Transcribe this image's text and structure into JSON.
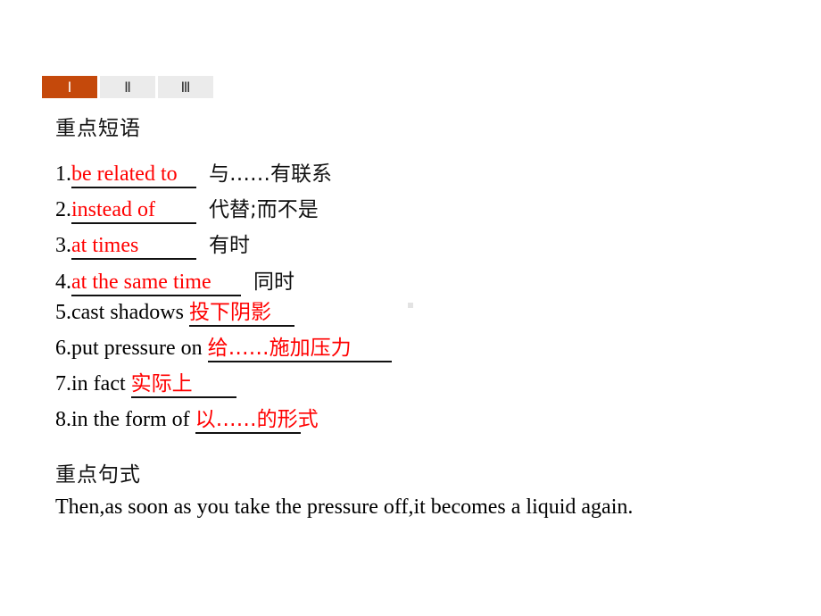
{
  "tabs": [
    {
      "label": "Ⅰ",
      "active": true
    },
    {
      "label": "Ⅱ",
      "active": false
    },
    {
      "label": "Ⅲ",
      "active": false
    }
  ],
  "section1": {
    "heading": "重点短语",
    "items": [
      {
        "number": "1.",
        "answer": "be related to",
        "meaning": "与……有联系"
      },
      {
        "number": "2.",
        "answer": "instead of",
        "meaning": "代替;而不是"
      },
      {
        "number": "3.",
        "answer": "at times",
        "meaning": "有时"
      },
      {
        "number": "4.",
        "answer": "at the same time",
        "meaning": "同时"
      },
      {
        "number": "5.",
        "phrase": "cast shadows",
        "answer": "投下阴影"
      },
      {
        "number": "6.",
        "phrase": "put pressure on",
        "answer": "给……施加压力"
      },
      {
        "number": "7.",
        "phrase": "in fact",
        "answer": "实际上"
      },
      {
        "number": "8.",
        "phrase": "in the form of",
        "answer": "以……的形式"
      }
    ]
  },
  "section2": {
    "heading": "重点句式",
    "sentence": "Then,as soon as you take the pressure off,it becomes a liquid again."
  },
  "colors": {
    "accent_tab": "#c5490b",
    "answer_red": "#ff0000",
    "inactive_tab": "#ebebeb"
  }
}
